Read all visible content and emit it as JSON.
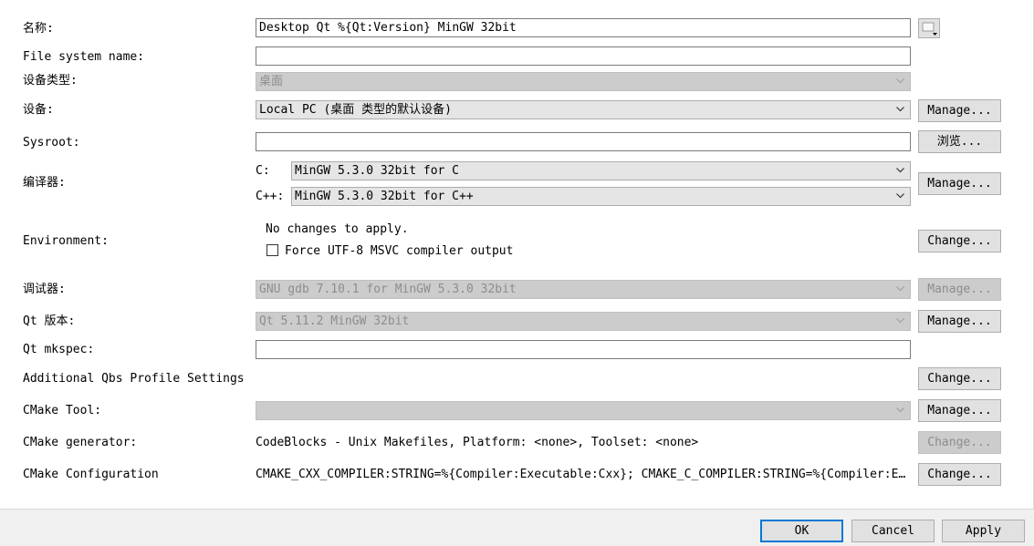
{
  "labels": {
    "name": "名称:",
    "fs_name": "File system name:",
    "device_type": "设备类型:",
    "device": "设备:",
    "sysroot": "Sysroot:",
    "compiler": "编译器:",
    "environment": "Environment:",
    "debugger": "调试器:",
    "qt_version": "Qt 版本:",
    "qt_mkspec": "Qt mkspec:",
    "qbs": "Additional Qbs Profile Settings",
    "cmake_tool": "CMake Tool:",
    "cmake_generator": "CMake generator:",
    "cmake_configuration": "CMake Configuration"
  },
  "fields": {
    "name_value": "Desktop Qt %{Qt:Version} MinGW 32bit",
    "fs_name_value": "",
    "device_type_value": "桌面",
    "device_value": "Local PC (桌面 类型的默认设备)",
    "sysroot_value": "",
    "compiler_c_label": "C:",
    "compiler_c_value": "MinGW 5.3.0 32bit for C",
    "compiler_cxx_label": "C++:",
    "compiler_cxx_value": "MinGW 5.3.0 32bit for C++",
    "env_text": "No changes to apply.",
    "force_utf8_label": "Force UTF-8 MSVC compiler output",
    "force_utf8_checked": false,
    "debugger_value": "GNU gdb 7.10.1 for MinGW 5.3.0 32bit",
    "qt_version_value": "Qt 5.11.2 MinGW 32bit",
    "qt_mkspec_value": "",
    "cmake_tool_value": "",
    "cmake_generator_value": "CodeBlocks - Unix Makefiles, Platform: <none>, Toolset: <none>",
    "cmake_configuration_value": "CMAKE_CXX_COMPILER:STRING=%{Compiler:Executable:Cxx}; CMAKE_C_COMPILER:STRING=%{Compiler:Executable:C}"
  },
  "buttons": {
    "manage": "Manage...",
    "browse": "浏览...",
    "change": "Change...",
    "ok": "OK",
    "cancel": "Cancel",
    "apply": "Apply"
  },
  "colors": {
    "accent": "#0078d7",
    "disabled_bg": "#cccccc",
    "disabled_text": "#8d8d8d"
  }
}
